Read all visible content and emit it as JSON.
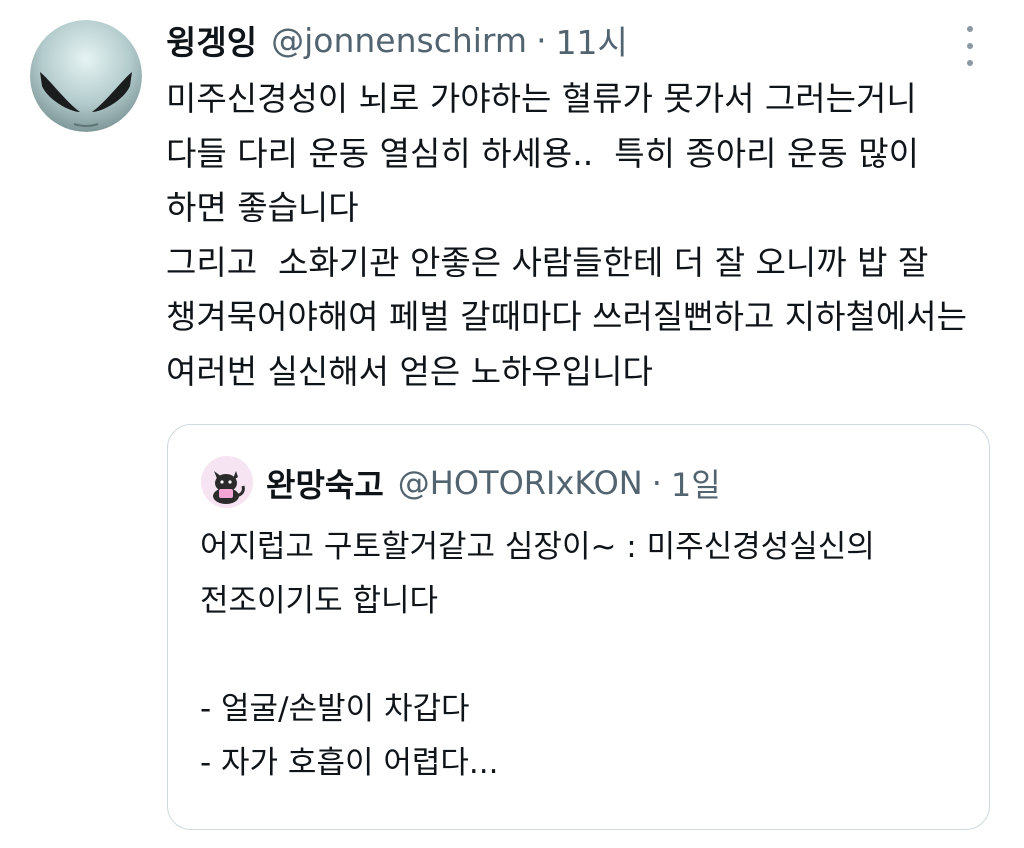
{
  "tweet": {
    "display_name": "윙겡잉",
    "handle": "@jonnenschirm",
    "separator": "·",
    "time": "11시",
    "avatar_icon": "alien-face-icon",
    "more_icon": "more-vertical-icon",
    "lines": [
      "미주신경성이 뇌로 가야하는 혈류가 못가서 그러는거니",
      "다들 다리 운동 열심히 하세용..  특히 종아리 운동 많이",
      "하면 좋습니다",
      "그리고  소화기관 안좋은 사람들한테 더 잘 오니까 밥 잘",
      "챙겨묵어야해여 페벌 갈때마다 쓰러질뻔하고 지하철에서는",
      "여러번 실신해서 얻은 노하우입니다"
    ]
  },
  "quote": {
    "display_name": "완망숙고",
    "handle": "@HOTORIxKON",
    "separator": "·",
    "time": "1일",
    "avatar_icon": "black-cat-icon",
    "lines": [
      "어지럽고 구토할거같고 심장이~ : 미주신경성실신의",
      "전조이기도 합니다",
      "",
      "- 얼굴/손발이 차갑다",
      "- 자가 호흡이 어렵다..."
    ]
  },
  "colors": {
    "text_primary": "#0f1419",
    "text_secondary": "#536471",
    "border": "#cfd9de"
  }
}
